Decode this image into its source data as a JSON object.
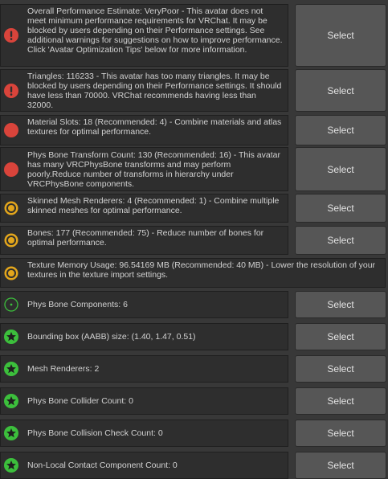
{
  "select_label": "Select",
  "colors": {
    "error": "#d9443b",
    "warning": "#e3a61c",
    "info": "#3cbf3c",
    "good": "#3cbf3c"
  },
  "items": [
    {
      "severity": "error-exclamation",
      "icon": "error-exclamation-icon",
      "text": "Overall Performance Estimate: VeryPoor - This avatar does not meet minimum performance requirements for VRChat. It may be blocked by users depending on their Performance settings. See additional warnings for suggestions on how to improve performance. Click 'Avatar Optimization Tips' below for more information.",
      "has_select": true
    },
    {
      "severity": "error-exclamation",
      "icon": "error-exclamation-icon",
      "text": "Triangles: 116233 - This avatar has too many triangles. It may be blocked by users depending on their Performance settings. It should have less than 70000. VRChat recommends having less than 32000.",
      "has_select": true
    },
    {
      "severity": "error-circle",
      "icon": "red-circle-icon",
      "text": "Material Slots: 18 (Recommended: 4) - Combine materials and atlas textures for optimal performance.",
      "has_select": true
    },
    {
      "severity": "error-circle",
      "icon": "red-circle-icon",
      "text": "Phys Bone Transform Count: 130 (Recommended: 16) - This avatar has many VRCPhysBone transforms and may perform poorly.Reduce number of transforms in hierarchy under VRCPhysBone components.",
      "has_select": true
    },
    {
      "severity": "warning",
      "icon": "warning-circle-icon",
      "text": "Skinned Mesh Renderers: 4 (Recommended: 1) - Combine multiple skinned meshes for optimal performance.",
      "has_select": true
    },
    {
      "severity": "warning",
      "icon": "warning-circle-icon",
      "text": "Bones: 177 (Recommended: 75) - Reduce number of bones for optimal performance.",
      "has_select": true
    },
    {
      "severity": "warning",
      "icon": "warning-circle-icon",
      "text": "Texture Memory Usage: 96.54169 MB (Recommended: 40 MB) - Lower the resolution of your textures in the texture import settings.",
      "has_select": false
    },
    {
      "severity": "info",
      "icon": "info-ring-icon",
      "text": "Phys Bone Components: 6",
      "has_select": true
    },
    {
      "severity": "good",
      "icon": "green-star-icon",
      "text": "Bounding box (AABB) size: (1.40, 1.47, 0.51)",
      "has_select": true
    },
    {
      "severity": "good",
      "icon": "green-star-icon",
      "text": "Mesh Renderers: 2",
      "has_select": true
    },
    {
      "severity": "good",
      "icon": "green-star-icon",
      "text": "Phys Bone Collider Count: 0",
      "has_select": true
    },
    {
      "severity": "good",
      "icon": "green-star-icon",
      "text": "Phys Bone Collision Check Count: 0",
      "has_select": true
    },
    {
      "severity": "good",
      "icon": "green-star-icon",
      "text": "Non-Local Contact Component Count: 0",
      "has_select": true
    }
  ]
}
